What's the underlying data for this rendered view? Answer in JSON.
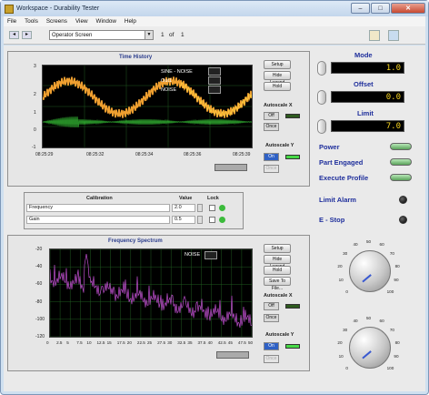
{
  "window": {
    "title": "Workspace - Durability Tester",
    "minimize": "–",
    "maximize": "□",
    "close": "✕"
  },
  "menu": [
    "File",
    "Tools",
    "Screens",
    "View",
    "Window",
    "Help"
  ],
  "toolbar": {
    "screen": "Operator Screen",
    "page": "1",
    "of": "of",
    "total": "1"
  },
  "time_history": {
    "title": "Time History",
    "legend": [
      "SINE - NOISE",
      "Out1",
      "NOISE"
    ],
    "buttons": {
      "setup": "Setup",
      "hide_legend": "Hide Legend",
      "hold": "Hold"
    },
    "autoscale_x": {
      "label": "Autoscale X",
      "off": "Off",
      "once": "Once"
    },
    "autoscale_y": {
      "label": "Autoscale Y",
      "on": "On",
      "once": "Once"
    },
    "y_ticks": [
      "3",
      "2",
      "1",
      "0",
      "-1"
    ],
    "x_ticks": [
      "08:25:29",
      "08:25:32",
      "08:25:34",
      "08:25:36",
      "08:25:39"
    ]
  },
  "calibration": {
    "headers": {
      "name": "Calibration",
      "value": "Value",
      "lock": "Lock"
    },
    "rows": [
      {
        "name": "Frequency",
        "value": "2.0"
      },
      {
        "name": "Gain",
        "value": "0.5"
      }
    ]
  },
  "frequency_spectrum": {
    "title": "Frequency Spectrum",
    "legend": [
      "NOISE"
    ],
    "buttons": {
      "setup": "Setup",
      "hide_legend": "Hide Legend",
      "hold": "Hold",
      "save": "Save To File..."
    },
    "autoscale_x": {
      "label": "Autoscale X",
      "off": "Off",
      "once": "Once"
    },
    "autoscale_y": {
      "label": "Autoscale Y",
      "on": "On",
      "once": "Once"
    },
    "y_ticks": [
      "-20",
      "-40",
      "-60",
      "-80",
      "-100",
      "-120"
    ],
    "x_ticks": [
      "0",
      "2.5",
      "5",
      "7.5",
      "10",
      "12.5",
      "15",
      "17.5",
      "20",
      "22.5",
      "25",
      "27.5",
      "30",
      "32.5",
      "35",
      "37.5",
      "40",
      "42.5",
      "45",
      "47.5",
      "50"
    ]
  },
  "indicators": {
    "mode": {
      "label": "Mode",
      "value": "1.0"
    },
    "offset": {
      "label": "Offset",
      "value": "0.0"
    },
    "limit": {
      "label": "Limit",
      "value": "7.0"
    },
    "power": "Power",
    "part_engaged": "Part Engaged",
    "execute_profile": "Execute Profile",
    "limit_alarm": "Limit Alarm",
    "estop": "E - Stop"
  },
  "knob": {
    "ticks": [
      "0",
      "10",
      "20",
      "30",
      "40",
      "50",
      "60",
      "70",
      "80",
      "90",
      "100"
    ]
  },
  "colors": {
    "plot_bg": "#000000",
    "grid": "#1f5a1f",
    "sine": "#f0a030",
    "out1": "#ffd040",
    "noise": "#38c838",
    "spectrum": "#c050d0",
    "label_blue": "#1f2f9c",
    "numeric": "#f3d020"
  }
}
